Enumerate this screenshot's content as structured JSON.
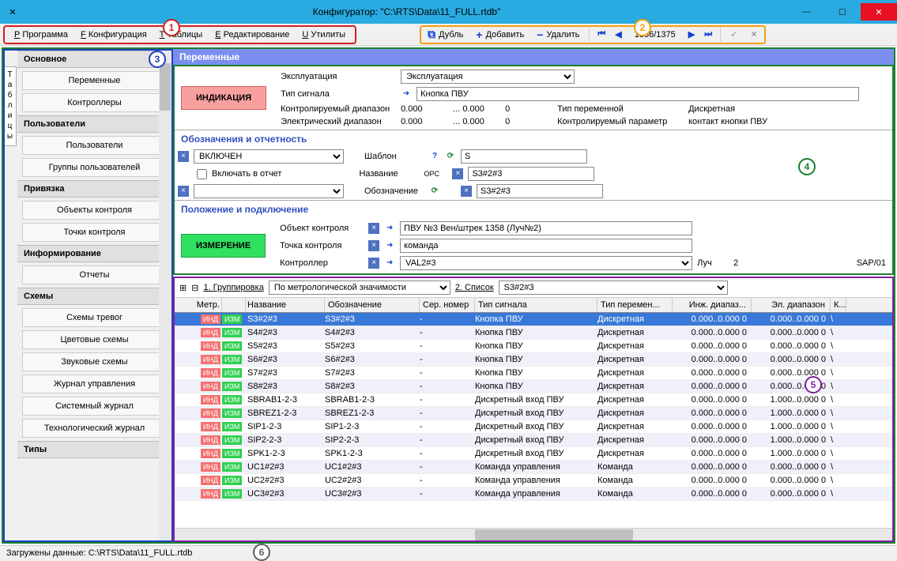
{
  "title": "Конфигуратор: \"C:\\RTS\\Data\\11_FULL.rtdb\"",
  "menu": {
    "program": "Программа",
    "config": "Конфигурация",
    "tables": "Таблицы",
    "edit": "Редактирование",
    "utils": "Утилиты"
  },
  "toolbar": {
    "dup": "Дубль",
    "add": "Добавить",
    "del": "Удалить",
    "page": "1336/1375"
  },
  "sidebar": {
    "tab": "Таблицы",
    "g1": "Основное",
    "i1": "Переменные",
    "i2": "Контроллеры",
    "g2": "Пользователи",
    "i3": "Пользователи",
    "i4": "Группы пользователей",
    "g3": "Привязка",
    "i5": "Объекты контроля",
    "i6": "Точки контроля",
    "g4": "Информирование",
    "i7": "Отчеты",
    "g5": "Схемы",
    "i8": "Схемы тревог",
    "i9": "Цветовые схемы",
    "i10": "Звуковые схемы",
    "i11": "Журнал управления",
    "i12": "Системный журнал",
    "i13": "Технологический журнал",
    "g6": "Типы"
  },
  "panel": {
    "title": "Переменные"
  },
  "form": {
    "ind": "ИНДИКАЦИЯ",
    "izm": "ИЗМЕРЕНИЕ",
    "expl_l": "Эксплуатация",
    "expl_v": "Эксплуатация",
    "sig_l": "Тип сигнала",
    "sig_v": "Кнопка ПВУ",
    "cr_l": "Контролируемый диапазон",
    "cr_v1": "0.000",
    "cr_v2": "0.000",
    "cr_v3": "0",
    "er_l": "Электрический диапазон",
    "er_v1": "0.000",
    "er_v2": "0.000",
    "er_v3": "0",
    "vt_l": "Тип переменной",
    "vt_v": "Дискретная",
    "cp_l": "Контролируемый параметр",
    "cp_v": "контакт кнопки ПВУ",
    "sec2": "Обозначения и отчетность",
    "on": "ВКЛЮЧЕН",
    "inc": "Включать в отчет",
    "tmpl_l": "Шаблон",
    "tmpl_v": "S",
    "name_l": "Название",
    "name_v": "S3#2#3",
    "des_l": "Обозначение",
    "des_v": "S3#2#3",
    "opc": "OPC",
    "sec3": "Положение и подключение",
    "obj_l": "Объект контроля",
    "obj_v": "ПВУ №3 Вен/штрек 1358 (Луч№2)",
    "pt_l": "Точка контроля",
    "pt_v": "команда",
    "ctl_l": "Контроллер",
    "ctl_v": "VAL2#3",
    "ray_l": "Луч",
    "ray_v": "2",
    "sap": "SAP/01"
  },
  "grid": {
    "grp_l": "1. Группировка",
    "grp_v": "По метрологической значимости",
    "list_l": "2. Список",
    "list_v": "S3#2#3",
    "h0": "Метр.",
    "h2": "Название",
    "h3": "Обозначение",
    "h4": "Сер. номер",
    "h5": "Тип сигнала",
    "h6": "Тип перемен...",
    "h7": "Инж. диапаз...",
    "h8": "Эл. диапазон",
    "h9": "К...",
    "rows": [
      {
        "n": "S3#2#3",
        "o": "S3#2#3",
        "s": "-",
        "t": "Кнопка ПВУ",
        "p": "Дискретная",
        "e": "0.000..0.000 0",
        "el": "0.000..0.000 0",
        "sel": true
      },
      {
        "n": "S4#2#3",
        "o": "S4#2#3",
        "s": "-",
        "t": "Кнопка ПВУ",
        "p": "Дискретная",
        "e": "0.000..0.000 0",
        "el": "0.000..0.000 0"
      },
      {
        "n": "S5#2#3",
        "o": "S5#2#3",
        "s": "-",
        "t": "Кнопка ПВУ",
        "p": "Дискретная",
        "e": "0.000..0.000 0",
        "el": "0.000..0.000 0"
      },
      {
        "n": "S6#2#3",
        "o": "S6#2#3",
        "s": "-",
        "t": "Кнопка ПВУ",
        "p": "Дискретная",
        "e": "0.000..0.000 0",
        "el": "0.000..0.000 0"
      },
      {
        "n": "S7#2#3",
        "o": "S7#2#3",
        "s": "-",
        "t": "Кнопка ПВУ",
        "p": "Дискретная",
        "e": "0.000..0.000 0",
        "el": "0.000..0.000 0"
      },
      {
        "n": "S8#2#3",
        "o": "S8#2#3",
        "s": "-",
        "t": "Кнопка ПВУ",
        "p": "Дискретная",
        "e": "0.000..0.000 0",
        "el": "0.000..0.000 0"
      },
      {
        "n": "SBRAB1-2-3",
        "o": "SBRAB1-2-3",
        "s": "-",
        "t": "Дискретный вход ПВУ",
        "p": "Дискретная",
        "e": "0.000..0.000 0",
        "el": "1.000..0.000 0"
      },
      {
        "n": "SBREZ1-2-3",
        "o": "SBREZ1-2-3",
        "s": "-",
        "t": "Дискретный вход ПВУ",
        "p": "Дискретная",
        "e": "0.000..0.000 0",
        "el": "1.000..0.000 0"
      },
      {
        "n": "SIP1-2-3",
        "o": "SIP1-2-3",
        "s": "-",
        "t": "Дискретный вход ПВУ",
        "p": "Дискретная",
        "e": "0.000..0.000 0",
        "el": "1.000..0.000 0"
      },
      {
        "n": "SIP2-2-3",
        "o": "SIP2-2-3",
        "s": "-",
        "t": "Дискретный вход ПВУ",
        "p": "Дискретная",
        "e": "0.000..0.000 0",
        "el": "1.000..0.000 0"
      },
      {
        "n": "SPK1-2-3",
        "o": "SPK1-2-3",
        "s": "-",
        "t": "Дискретный вход ПВУ",
        "p": "Дискретная",
        "e": "0.000..0.000 0",
        "el": "1.000..0.000 0"
      },
      {
        "n": "UC1#2#3",
        "o": "UC1#2#3",
        "s": "-",
        "t": "Команда управления",
        "p": "Команда",
        "e": "0.000..0.000 0",
        "el": "0.000..0.000 0"
      },
      {
        "n": "UC2#2#3",
        "o": "UC2#2#3",
        "s": "-",
        "t": "Команда управления",
        "p": "Команда",
        "e": "0.000..0.000 0",
        "el": "0.000..0.000 0"
      },
      {
        "n": "UC3#2#3",
        "o": "UC3#2#3",
        "s": "-",
        "t": "Команда управления",
        "p": "Команда",
        "e": "0.000..0.000 0",
        "el": "0.000..0.000 0"
      }
    ]
  },
  "status": "Загружены данные: C:\\RTS\\Data\\11_FULL.rtdb",
  "tags": {
    "ind": "ИНД",
    "izm": "ИЗМ"
  }
}
